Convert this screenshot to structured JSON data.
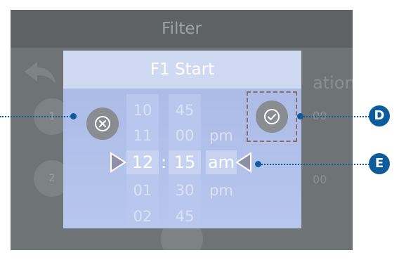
{
  "background_screen": {
    "title": "Filter",
    "partial_heading": "ation",
    "row1_number": "1",
    "row2_number": "2",
    "row1_value": "00",
    "row2_value": "00"
  },
  "dialog": {
    "title": "F1 Start",
    "hours": [
      "10",
      "11",
      "12",
      "01",
      "02"
    ],
    "minutes": [
      "45",
      "00",
      "15",
      "30",
      "45"
    ],
    "ampm": [
      "pm",
      "am",
      "pm"
    ],
    "separator": ":",
    "selected": {
      "hour": "12",
      "minute": "15",
      "ampm": "am"
    }
  },
  "callouts": {
    "d": "D",
    "e": "E"
  },
  "icons": {
    "cancel": "circle-x-icon",
    "confirm": "circle-check-icon",
    "back": "back-arrow-icon",
    "left_arrow": "triangle-right-icon",
    "right_arrow": "triangle-left-icon"
  },
  "colors": {
    "callout": "#0e5c9c",
    "dialog_bg": "#b7c6ee",
    "screen_bg": "#6e7376"
  }
}
